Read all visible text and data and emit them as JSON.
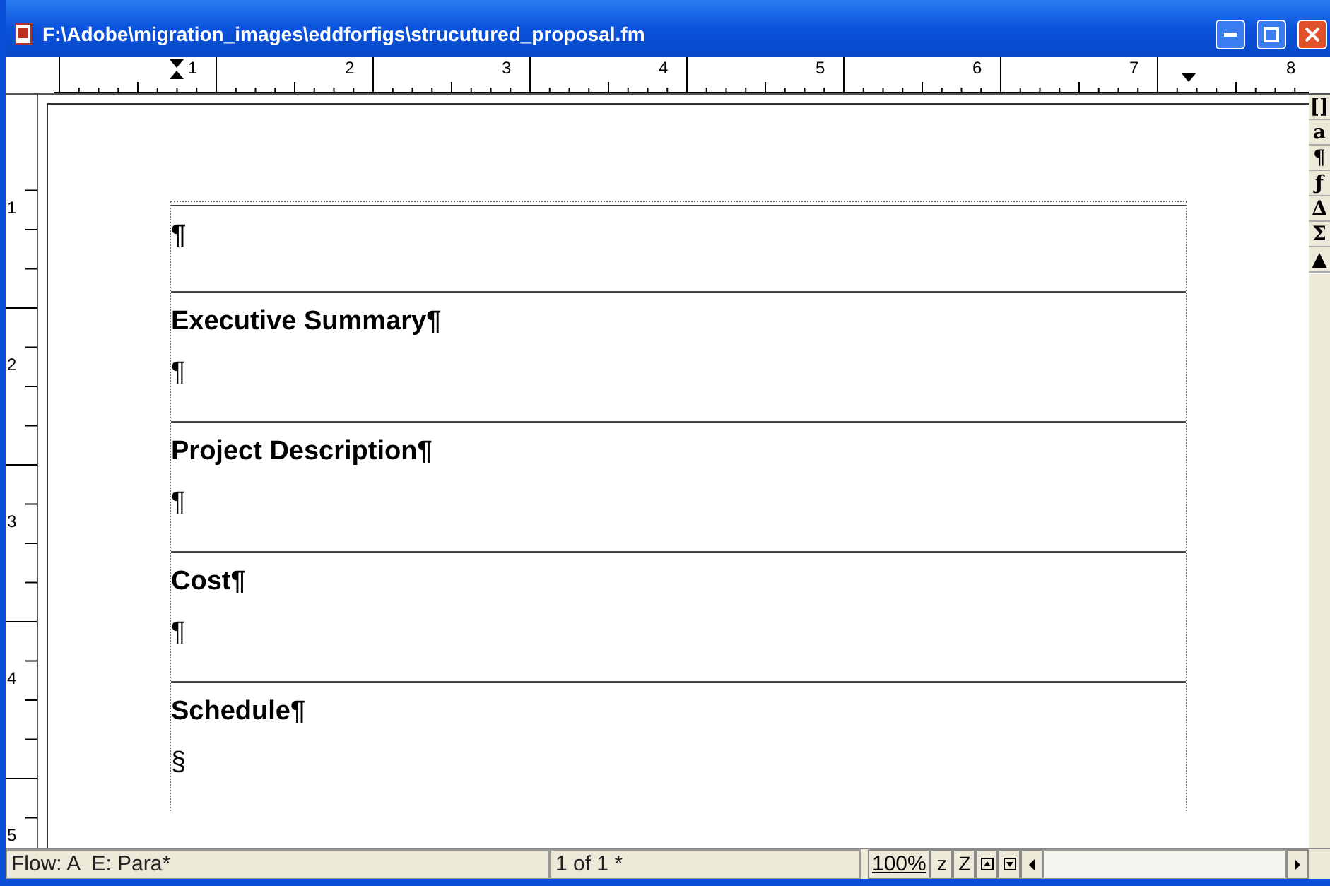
{
  "window": {
    "title": "F:\\Adobe\\migration_images\\eddforfigs\\strucutured_proposal.fm"
  },
  "ruler": {
    "horizontal": [
      "1",
      "2",
      "3",
      "4",
      "5",
      "6",
      "7",
      "8"
    ],
    "vertical": [
      "1",
      "2",
      "3",
      "4",
      "5"
    ]
  },
  "side_toolbar": [
    "[]",
    "a",
    "¶",
    "ƒ",
    "∆",
    "Σ",
    "▲"
  ],
  "document": {
    "sections": [
      {
        "kind": "empty",
        "heading": "¶"
      },
      {
        "kind": "heading",
        "heading": "Executive Summary¶",
        "body": "¶"
      },
      {
        "kind": "heading",
        "heading": "Project Description¶",
        "body": "¶"
      },
      {
        "kind": "heading",
        "heading": "Cost¶",
        "body": "¶"
      },
      {
        "kind": "heading",
        "heading": "Schedule¶",
        "body": "§"
      }
    ]
  },
  "status_bar": {
    "flow": "Flow: A  E: Para*",
    "page": "1 of 1 *",
    "zoom": "100%",
    "zoom_out": "z",
    "zoom_in": "Z"
  }
}
